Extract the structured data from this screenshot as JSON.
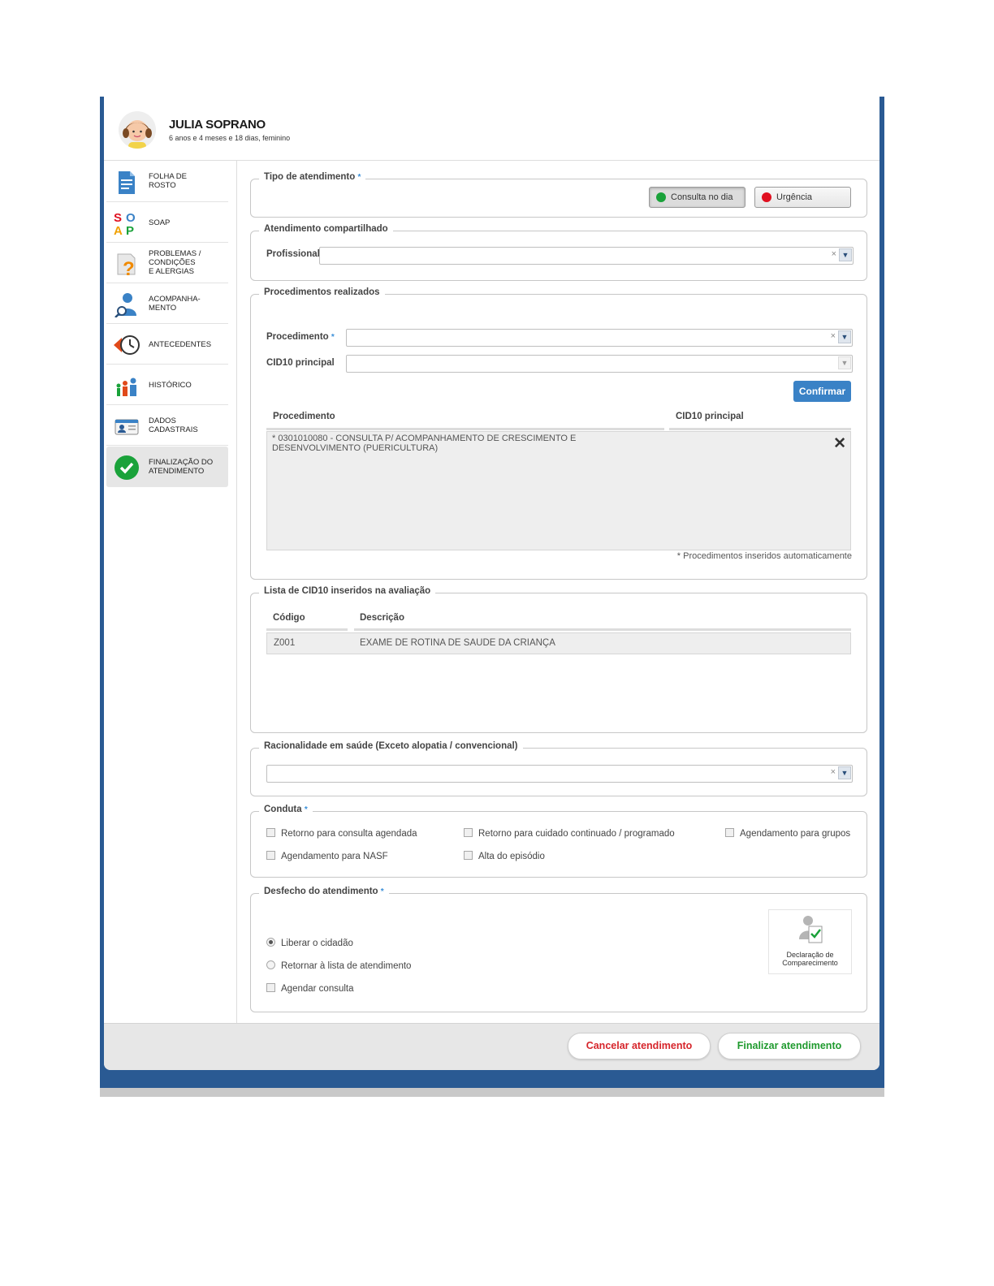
{
  "patient": {
    "name": "JULIA SOPRANO",
    "info": "6 anos e 4 meses e 18 dias, feminino"
  },
  "sidebar": {
    "items": [
      {
        "label1": "FOLHA DE",
        "label2": "ROSTO",
        "label3": "",
        "icon": "document-icon"
      },
      {
        "label1": "SOAP",
        "label2": "",
        "label3": "",
        "icon": "soap-icon"
      },
      {
        "label1": "PROBLEMAS /",
        "label2": "CONDIÇÕES",
        "label3": "E ALERGIAS",
        "icon": "question-icon"
      },
      {
        "label1": "ACOMPANHA-",
        "label2": "MENTO",
        "label3": "",
        "icon": "person-search-icon"
      },
      {
        "label1": "ANTECEDENTES",
        "label2": "",
        "label3": "",
        "icon": "history-clock-icon"
      },
      {
        "label1": "HISTÓRICO",
        "label2": "",
        "label3": "",
        "icon": "family-icon"
      },
      {
        "label1": "DADOS",
        "label2": "CADASTRAIS",
        "label3": "",
        "icon": "id-card-icon"
      },
      {
        "label1": "FINALIZAÇÃO DO",
        "label2": "ATENDIMENTO",
        "label3": "",
        "icon": "check-circle-icon"
      }
    ]
  },
  "tipo": {
    "legend": "Tipo de atendimento",
    "required_mark": "*",
    "btn_consulta": "Consulta no dia",
    "btn_urgencia": "Urgência"
  },
  "compartilhado": {
    "legend": "Atendimento compartilhado",
    "profissional_label": "Profissional",
    "clear": "×"
  },
  "procedimentos": {
    "legend": "Procedimentos realizados",
    "procedimento_label": "Procedimento",
    "cid_label": "CID10 principal",
    "confirm": "Confirmar",
    "col_proc": "Procedimento",
    "col_cid": "CID10 principal",
    "row_line1": "* 0301010080 - CONSULTA P/ ACOMPANHAMENTO DE CRESCIMENTO E",
    "row_line2": "DESENVOLVIMENTO (PUERICULTURA)",
    "remove": "✕",
    "footnote": "* Procedimentos inseridos automaticamente"
  },
  "cid_list": {
    "legend": "Lista de CID10 inseridos na avaliação",
    "col_codigo": "Código",
    "col_desc": "Descrição",
    "rows": [
      {
        "codigo": "Z001",
        "descricao": "EXAME DE ROTINA DE SAUDE DA CRIANÇA"
      }
    ]
  },
  "racionalidade": {
    "legend": "Racionalidade em saúde (Exceto alopatia / convencional)"
  },
  "conduta": {
    "legend": "Conduta",
    "options": [
      "Retorno para consulta agendada",
      "Retorno para cuidado continuado / programado",
      "Agendamento para grupos",
      "Agendamento para NASF",
      "Alta do episódio"
    ]
  },
  "desfecho": {
    "legend": "Desfecho do atendimento",
    "opt_liberar": "Liberar o cidadão",
    "opt_retornar": "Retornar à lista de atendimento",
    "opt_agendar": "Agendar consulta",
    "decl_line1": "Declaração de",
    "decl_line2": "Comparecimento"
  },
  "footer": {
    "cancel": "Cancelar atendimento",
    "finish": "Finalizar atendimento"
  },
  "colors": {
    "frame": "#2a5a93",
    "green": "#1aa23a",
    "red": "#e01020",
    "accent_blue": "#3a82c6",
    "cancel_text": "#d6252b",
    "finish_text": "#1f9a2e"
  }
}
